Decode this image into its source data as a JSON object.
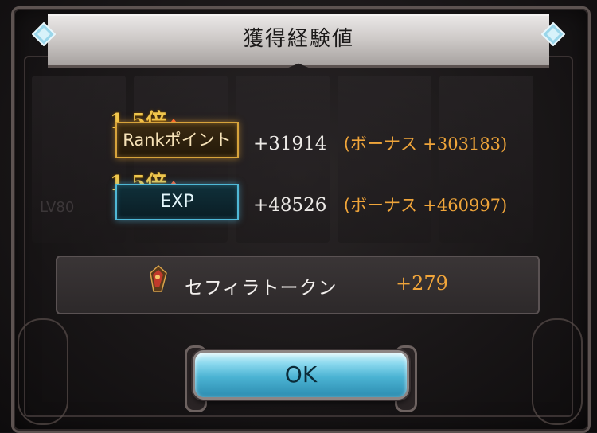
{
  "dialog": {
    "title": "獲得経験値"
  },
  "background": {
    "level_label": "LV80"
  },
  "rewards": {
    "rank": {
      "multiplier": "1.5倍",
      "label": "Rankポイント",
      "value": "+31914",
      "bonus_label": "(ボーナス",
      "bonus_value": "+303183)"
    },
    "exp": {
      "multiplier": "1.5倍",
      "label": "EXP",
      "value": "+48526",
      "bonus_label": "(ボーナス",
      "bonus_value": "+460997)"
    }
  },
  "item": {
    "icon": "sephira-token-icon",
    "name": "セフィラトークン",
    "amount": "+279"
  },
  "ok_button": {
    "label": "OK"
  },
  "colors": {
    "rank_badge_border": "#d7a33b",
    "exp_badge_border": "#4fb8d6",
    "bonus_text": "#f0a53a",
    "multiplier_text": "#f0c74e",
    "ok_button": "#4bb3d3"
  }
}
